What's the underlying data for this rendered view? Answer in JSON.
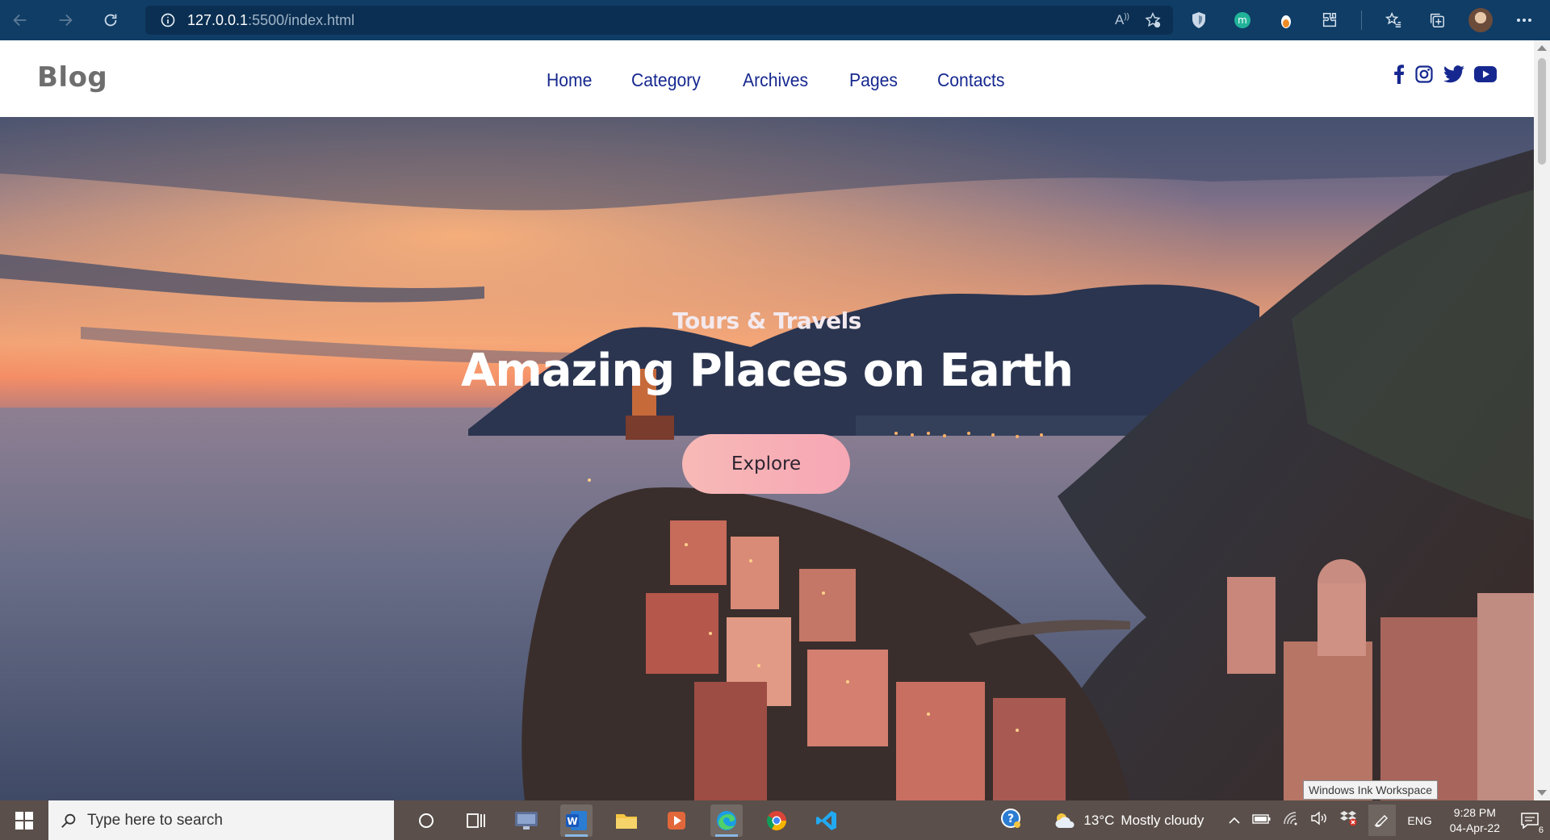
{
  "browser": {
    "url_host": "127.0.0.1",
    "url_path": ":5500/index.html",
    "read_aloud_label": "A͡",
    "extensions": [
      "shield-extension",
      "m-extension",
      "honey-extension",
      "puzzle-extension"
    ]
  },
  "site": {
    "logo": "Blog",
    "nav": [
      "Home",
      "Category",
      "Archives",
      "Pages",
      "Contacts"
    ],
    "social": [
      "facebook-icon",
      "instagram-icon",
      "twitter-icon",
      "youtube-icon"
    ],
    "brand_color": "#16288f"
  },
  "hero": {
    "kicker": "Tours & Travels",
    "headline": "Amazing Places on Earth",
    "cta": "Explore"
  },
  "tooltip": "Windows Ink Workspace",
  "taskbar": {
    "search_placeholder": "Type here to search",
    "apps": [
      "cortana-icon",
      "task-view-icon",
      "monitor-app-icon",
      "word-icon",
      "file-explorer-icon",
      "media-player-icon",
      "edge-icon",
      "chrome-icon",
      "vscode-icon"
    ],
    "weather_temp": "13°C",
    "weather_desc": "Mostly cloudy",
    "lang": "ENG",
    "time": "9:28 PM",
    "date": "04-Apr-22",
    "notification_count": "6"
  }
}
